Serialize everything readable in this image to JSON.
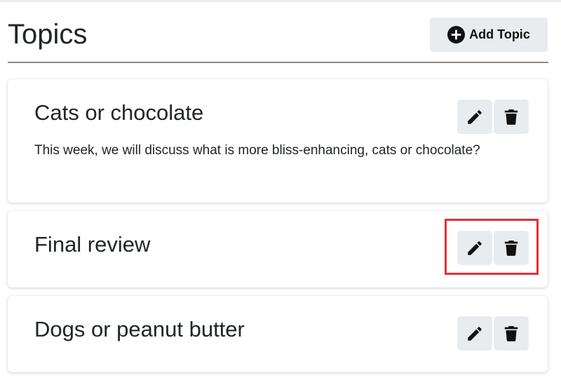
{
  "header": {
    "title": "Topics",
    "add_button_label": "Add Topic"
  },
  "topics": [
    {
      "title": "Cats or chocolate",
      "description": "This week, we will discuss what is more bliss-enhancing, cats or chocolate?"
    },
    {
      "title": "Final review",
      "description": ""
    },
    {
      "title": "Dogs or peanut butter",
      "description": ""
    }
  ],
  "icons": {
    "add": "plus-circle-icon",
    "edit": "pencil-icon",
    "delete": "trash-icon"
  },
  "colors": {
    "button_bg": "#e9ecef",
    "highlight_border": "#e0313b",
    "text": "#212529"
  }
}
